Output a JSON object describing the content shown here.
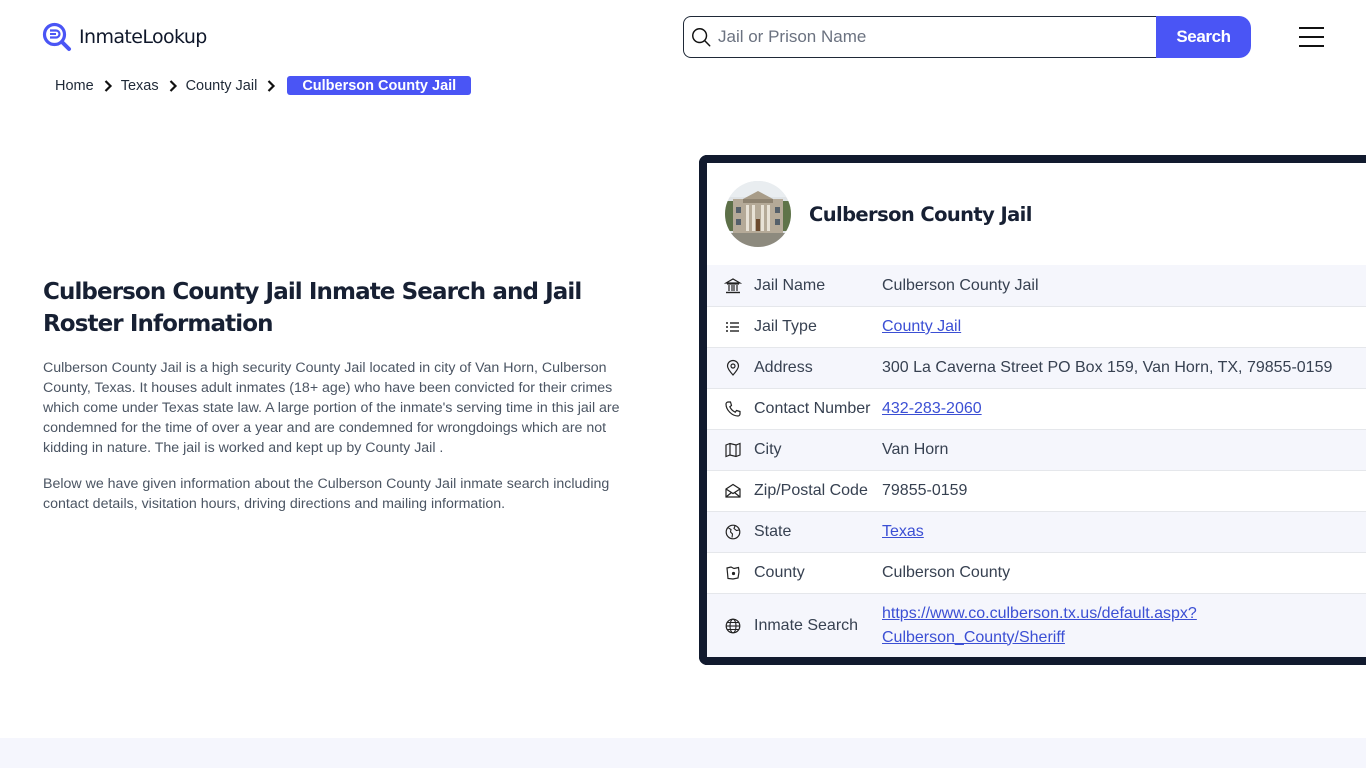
{
  "header": {
    "logo_text": "InmateLookup",
    "search": {
      "placeholder": "Jail or Prison Name",
      "value": "",
      "button_label": "Search"
    },
    "menu_icon": "hamburger-menu-icon"
  },
  "breadcrumb": {
    "items": [
      {
        "label": "Home"
      },
      {
        "label": "Texas"
      },
      {
        "label": "County Jail"
      }
    ],
    "current": "Culberson County Jail"
  },
  "intro": {
    "title": "Culberson County Jail Inmate Search and Jail Roster Information",
    "paragraphs": [
      "Culberson County Jail is a high security County Jail located in city of Van Horn, Culberson County, Texas. It houses adult inmates (18+ age) who have been convicted for their crimes which come under Texas state law. A large portion of the inmate's serving time in this jail are condemned for the time of over a year and are condemned for wrongdoings which are not kidding in nature. The jail is worked and kept up by County Jail .",
      "Below we have given information about the Culberson County Jail inmate search including contact details, visitation hours, driving directions and mailing information."
    ]
  },
  "card": {
    "title": "Culberson County Jail",
    "rows": [
      {
        "icon": "building-icon",
        "label": "Jail Name",
        "value": "Culberson County Jail",
        "link": false
      },
      {
        "icon": "list-icon",
        "label": "Jail Type",
        "value": "County Jail",
        "link": true
      },
      {
        "icon": "map-pin-icon",
        "label": "Address",
        "value": "300 La Caverna Street PO Box 159, Van Horn, TX, 79855-0159",
        "link": false
      },
      {
        "icon": "phone-icon",
        "label": "Contact Number",
        "value": "432-283-2060",
        "link": true
      },
      {
        "icon": "map-icon",
        "label": "City",
        "value": "Van Horn",
        "link": false
      },
      {
        "icon": "envelope-icon",
        "label": "Zip/Postal Code",
        "value": "79855-0159",
        "link": false
      },
      {
        "icon": "globe-region-icon",
        "label": "State",
        "value": "Texas",
        "link": true
      },
      {
        "icon": "county-map-icon",
        "label": "County",
        "value": "Culberson County",
        "link": false
      },
      {
        "icon": "globe-icon",
        "label": "Inmate Search",
        "value_line1": "https://www.co.culberson.tx.us/default.aspx?",
        "value_line2": "Culberson_County/Sheriff",
        "link": true
      }
    ]
  },
  "colors": {
    "accent": "#4a55f5",
    "card_border": "#111a2e",
    "row_alt_bg": "#f5f6fc",
    "link": "#3b4fd4"
  }
}
